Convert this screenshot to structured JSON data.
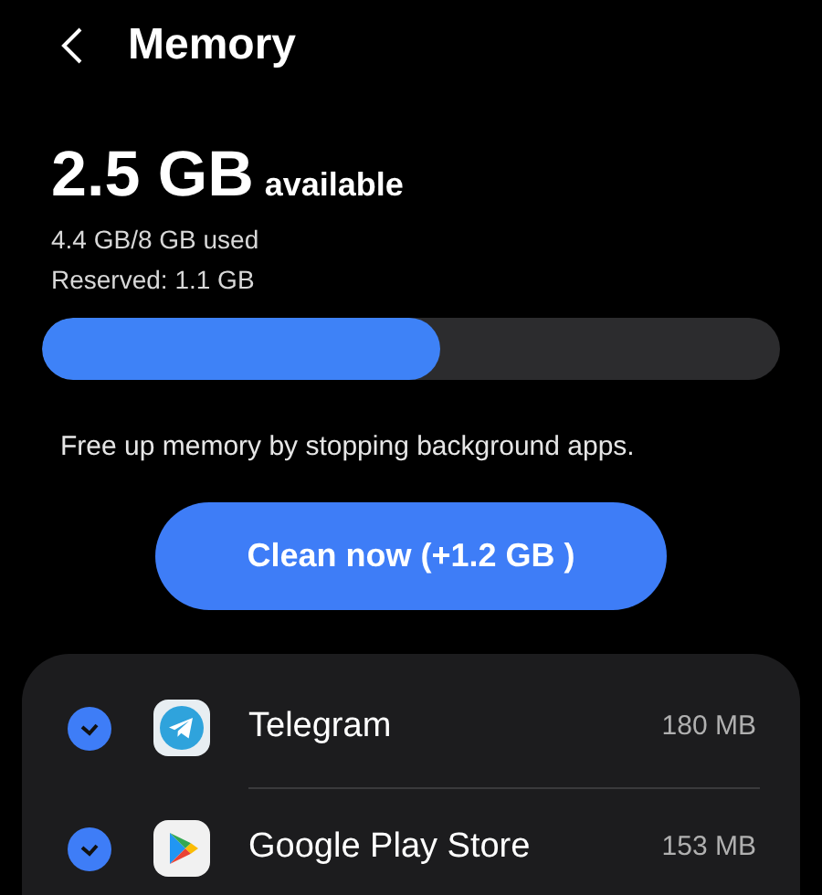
{
  "header": {
    "title": "Memory"
  },
  "summary": {
    "available": "2.5 GB",
    "available_label": "available",
    "used": "4.4 GB/8 GB used",
    "reserved": "Reserved: 1.1 GB",
    "level": 0.54
  },
  "hint": "Free up memory by stopping background apps.",
  "clean_button": "Clean now (+1.2 GB )",
  "apps": [
    {
      "name": "Telegram",
      "size": "180 MB",
      "checked": true,
      "kind": "telegram"
    },
    {
      "name": "Google Play Store",
      "size": "153 MB",
      "checked": true,
      "kind": "playstore"
    }
  ]
}
